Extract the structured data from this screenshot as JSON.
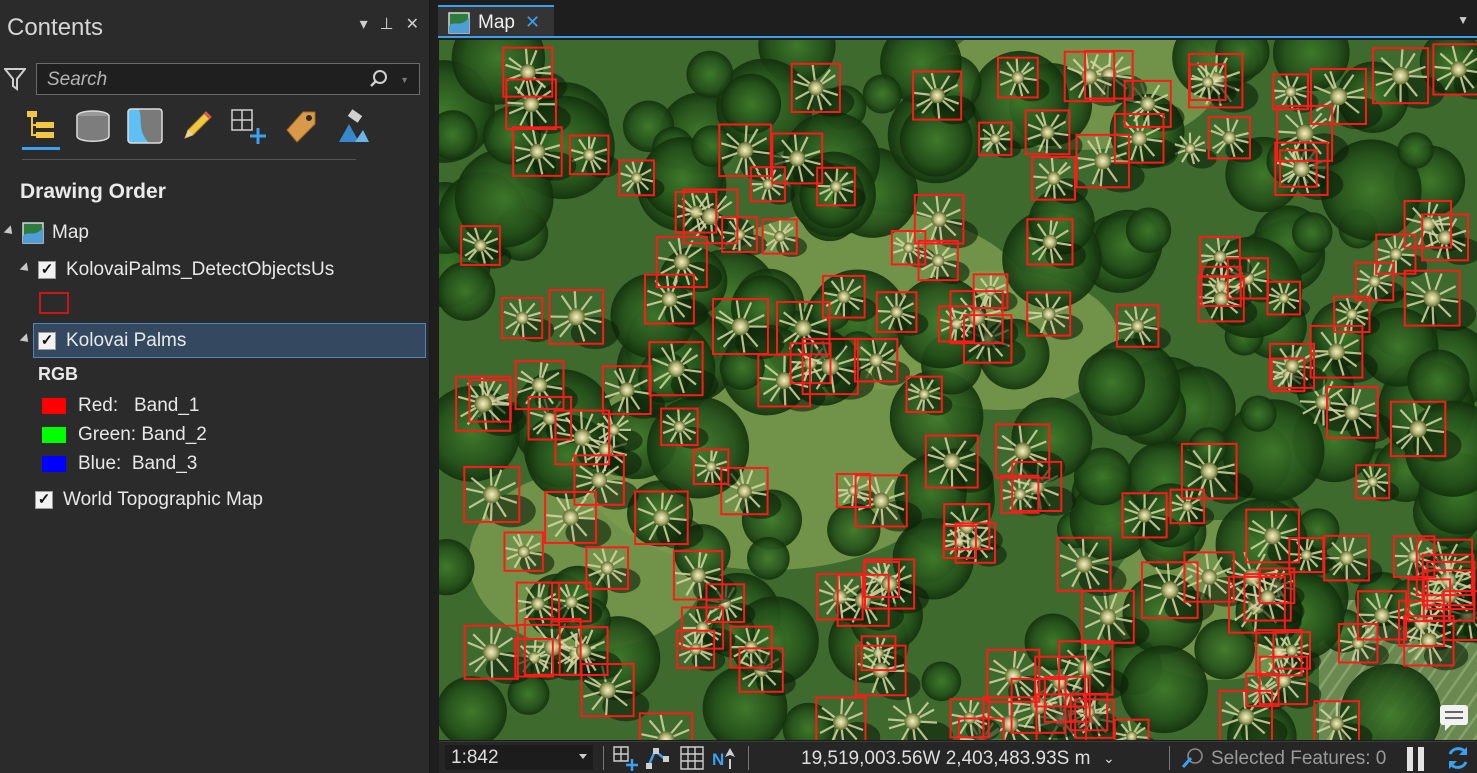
{
  "contents_pane": {
    "title": "Contents",
    "search": {
      "placeholder": "Search",
      "value": ""
    },
    "toolbar_icons": [
      "drawing-order-icon",
      "data-source-icon",
      "selection-icon",
      "editing-icon",
      "snapping-icon",
      "labeling-icon",
      "perspective-imagery-icon"
    ],
    "section_title": "Drawing Order",
    "tree": {
      "map_label": "Map",
      "layers": [
        {
          "label": "KolovaiPalms_DetectObjectsUs",
          "checked": true
        },
        {
          "label": "Kolovai Palms",
          "checked": true,
          "selected": true
        },
        {
          "label": "World Topographic Map",
          "checked": true
        }
      ],
      "rgb": {
        "heading": "RGB",
        "bands": [
          {
            "label": "Red:   Band_1",
            "color": "#ff0000"
          },
          {
            "label": "Green: Band_2",
            "color": "#00ff00"
          },
          {
            "label": "Blue:  Band_3",
            "color": "#0000ff"
          }
        ]
      },
      "symbol_color": "#d01010"
    }
  },
  "map_view": {
    "tab_label": "Map",
    "accent_color": "#3aa0f0",
    "detection_box_color": "#ff1a1a"
  },
  "status_bar": {
    "scale": "1:842",
    "coordinates": "19,519,003.56W 2,403,483.93S m",
    "selected_features": "Selected Features: 0"
  }
}
